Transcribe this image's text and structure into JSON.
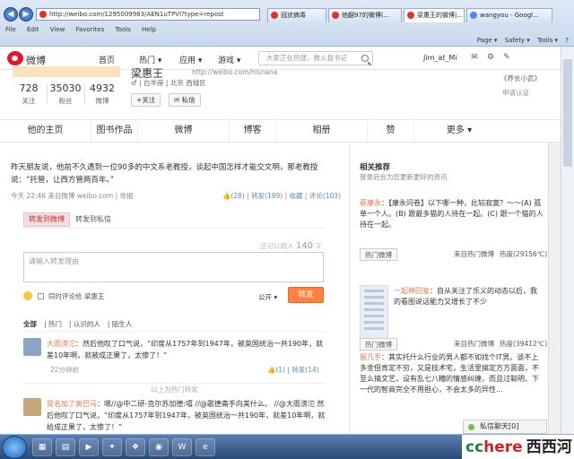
{
  "browser": {
    "url": "http://weibo.com/1295009983/AEN1uTPVI?type=repost",
    "tabs": [
      {
        "title": "冠状病毒"
      },
      {
        "title": "他翻97的微博(..."
      },
      {
        "title": "梁惠王的微博|..."
      },
      {
        "title": "wangyou - Googl..."
      }
    ],
    "menu": [
      "File",
      "Edit",
      "View",
      "Favorites",
      "Tools",
      "Help"
    ],
    "commands": [
      "Page ▾",
      "Safety ▾",
      "Tools ▾",
      "?"
    ]
  },
  "weibo_nav": {
    "logo": "微博",
    "home": "首页",
    "hot": "热门 ▾",
    "apps": "应用 ▾",
    "games": "游戏 ▾",
    "search_placeholder": "大家正在热搜，救火县书记",
    "user": "Jim_at_Mi"
  },
  "profile": {
    "name": "梁惠王",
    "url": "http://weibo.com/hisnana",
    "stats": [
      {
        "num": "728",
        "label": "关注"
      },
      {
        "num": "35030",
        "label": "粉丝"
      },
      {
        "num": "4932",
        "label": "微博"
      }
    ],
    "location": "♂ | 白羊座 | 北京 西城区",
    "follow_label": "+关注",
    "message_label": "✉ 私信",
    "right_title": "《养长小武》",
    "right_link": "申请认证"
  },
  "profile_tabs": [
    "他的主页",
    "图书作品",
    "微博",
    "博客",
    "相册",
    "赞",
    "更多 ▾"
  ],
  "original": {
    "text": "昨天朋友说，他前不久遇到一位90多的中文系老教授，谈起中国怎样才能交文明，那老教授说：“托管，让西方管两百年。”",
    "time": "今天 22:46",
    "source": "来自微博 weibo.com",
    "report": "举报",
    "likes": "(28)",
    "reposts": "转发(189)",
    "favorite": "收藏",
    "comments": "评论(103)"
  },
  "repost_box": {
    "tab_repost": "转发到微博",
    "tab_private": "转发到私信",
    "limit_prefix": "还可以输入",
    "limit_num": "140",
    "limit_suffix": "字",
    "placeholder": "请输入转发理由",
    "also_comment": "同时评论给 梁惠王",
    "visibility": "公开 ▾",
    "send": "转发"
  },
  "filters": [
    "全部",
    "热门",
    "认识的人",
    "陌生人"
  ],
  "comments": [
    {
      "user": "大雨滂沱",
      "text": "：然后他叹了口气说，“印度从1757年到1947年，被英国统治一共190年，就差10年啊，就被成正果了，太惨了！”",
      "time": "22分钟前",
      "likes": "(1)",
      "reposts": "转发(14)"
    },
    {
      "user": "受名加了奥巴马",
      "text": "：嗯//@中二研-克尔苏加德:嘻 //@歌德斋手向美什么。 //@大雨滂沱 然后他叹了口气说，“印度从1757年到1947年，被英国统治一共190年，就差10年啊，就给成正果了，太惨了！”"
    }
  ],
  "hot_separator": "以上为热门转发",
  "sidebar": {
    "title": "相关推荐",
    "subtitle": "登录后会为您更新更好的资讯",
    "items": [
      {
        "user": "蔡康永",
        "text": "：【康永问卷】以下哪一种，比较寂寞？～～(A) 孤单一个人。(B) 跟最多猫的人待在一起。(C) 跟一个猫的人待在一起。",
        "button": "热门微博",
        "from": "来自热门微博",
        "heat": "热度(29156℃)"
      },
      {
        "user": "一起神回复",
        "text": "：自从关注了乐义的动态以后，我的看图说话能力又增长了不少",
        "button": "热门微博",
        "from": "来自热门微博",
        "heat": "热度(39412℃)"
      },
      {
        "user": "留几手",
        "text": "：其实托什么行业的男人都不如找个IT男。谈不上多金但肯定不穷，又是技术宅，生活里搞定方方面面，不至么搞文艺，设有乱七八糟的情感纠缠，而且过聪明、下一代的智商完全不用担心，不会太多的异性..."
      }
    ]
  },
  "chat_label": "私信聊天[0]",
  "brand": {
    "a": "cc",
    "b": "here",
    "c": "西西河"
  }
}
